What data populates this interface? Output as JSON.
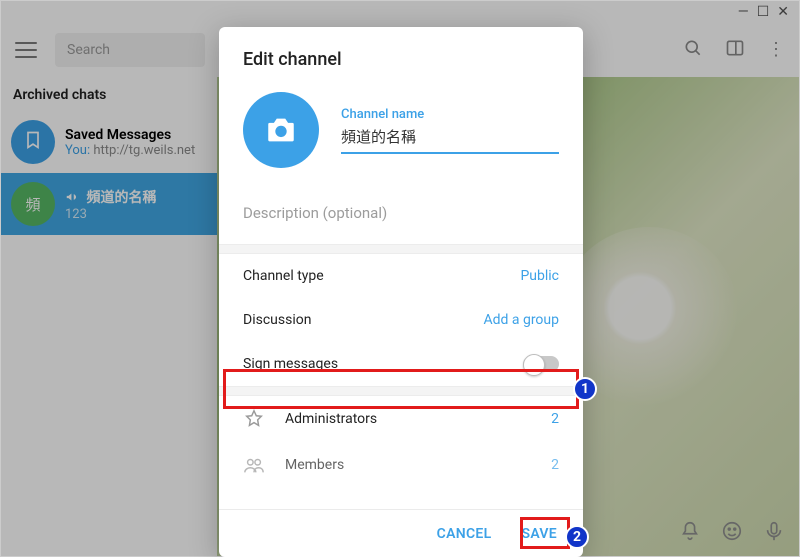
{
  "window": {
    "min": "—",
    "max": "☐",
    "close": "✕"
  },
  "toolbar": {
    "search_placeholder": "Search"
  },
  "sidebar": {
    "archived_label": "Archived chats",
    "items": [
      {
        "title": "Saved Messages",
        "prefix": "You:",
        "sub": "http://tg.weils.net"
      },
      {
        "avatar_text": "頻",
        "title": "頻道的名稱",
        "sub": "123"
      }
    ]
  },
  "modal": {
    "title": "Edit channel",
    "name_label": "Channel name",
    "name_value": "頻道的名稱",
    "desc_placeholder": "Description (optional)",
    "rows": {
      "channel_type_label": "Channel type",
      "channel_type_value": "Public",
      "discussion_label": "Discussion",
      "discussion_value": "Add a group",
      "sign_messages_label": "Sign messages"
    },
    "lists": {
      "administrators_label": "Administrators",
      "administrators_count": "2",
      "members_label": "Members",
      "members_count": "2"
    },
    "buttons": {
      "cancel": "CANCEL",
      "save": "SAVE"
    }
  },
  "annotations": {
    "badge1": "1",
    "badge2": "2"
  }
}
